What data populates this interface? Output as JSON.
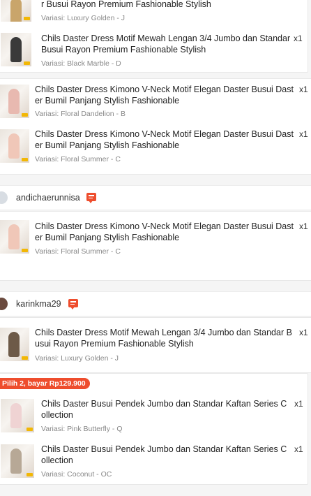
{
  "blocks": [
    {
      "id": "a1",
      "title": "r Busui Rayon Premium Fashionable Stylish",
      "variant": "Variasi: Luxury Golden - J"
    },
    {
      "id": "a2",
      "title": "Chils Daster Dress Motif Mewah Lengan 3/4 Jumbo dan Standar Busui Rayon Premium Fashionable Stylish",
      "variant": "Variasi: Black Marble - D",
      "qty": "x1"
    },
    {
      "id": "b1",
      "title": "Chils Daster Dress Kimono V-Neck Motif Elegan Daster Busui Daster Bumil Panjang Stylish Fashionable",
      "variant": "Variasi: Floral Dandelion - B",
      "qty": "x1"
    },
    {
      "id": "b2",
      "title": "Chils Daster Dress Kimono V-Neck Motif Elegan Daster Busui Daster Bumil Panjang Stylish Fashionable",
      "variant": "Variasi: Floral Summer - C",
      "qty": "x1"
    },
    {
      "id": "c1",
      "title": "Chils Daster Dress Kimono V-Neck Motif Elegan Daster Busui Daster Bumil Panjang Stylish Fashionable",
      "variant": "Variasi: Floral Summer - C",
      "qty": "x1"
    },
    {
      "id": "d1",
      "title": "Chils Daster Dress Motif Mewah Lengan 3/4 Jumbo dan Standar Busui Rayon Premium Fashionable Stylish",
      "variant": "Variasi: Luxury Golden - J",
      "qty": "x1"
    },
    {
      "id": "e1",
      "title": "Chils Daster Busui Pendek Jumbo dan Standar Kaftan Series Collection",
      "variant": "Variasi: Pink Butterfly - Q",
      "qty": "x1"
    },
    {
      "id": "e2",
      "title": "Chils Daster Busui Pendek Jumbo dan Standar Kaftan Series Collection",
      "variant": "Variasi: Coconut - OC",
      "qty": "x1"
    }
  ],
  "shops": [
    {
      "name": "andichaerunnisa",
      "icon": "chat-icon"
    },
    {
      "name": "karinkma29",
      "icon": "chat-icon"
    }
  ],
  "promo": "Pilih 2, bayar Rp129.900",
  "colors": {
    "accent": "#ee4d2d",
    "text": "#222222",
    "muted": "#888888",
    "background": "#f5f5f5"
  }
}
